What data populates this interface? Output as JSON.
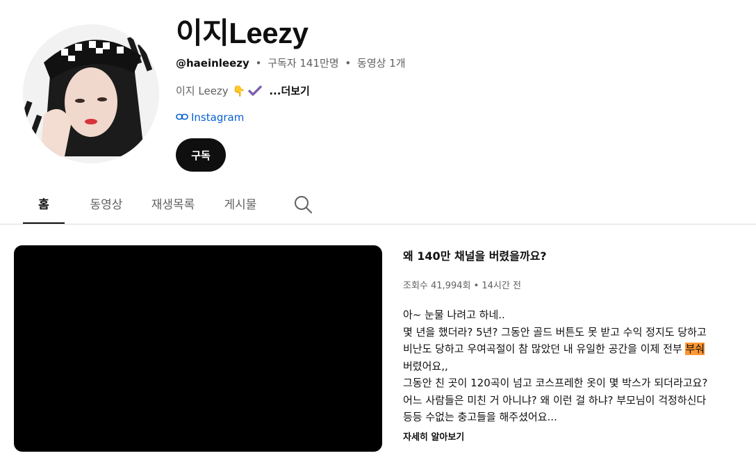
{
  "channel": {
    "name": "이지Leezy",
    "handle": "@haeinleezy",
    "separator": "•",
    "subscribers": "구독자 141만명",
    "videos": "동영상 1개",
    "description": "이지 Leezy",
    "description_emoji": "👇",
    "more_label": "...더보기",
    "link_label": "Instagram",
    "subscribe_label": "구독"
  },
  "tabs": [
    {
      "label": "홈",
      "active": true
    },
    {
      "label": "동영상"
    },
    {
      "label": "재생목록"
    },
    {
      "label": "게시물"
    }
  ],
  "featured_video": {
    "title": "왜 140만 채널을 버렸을까요?",
    "stats": "조회수 41,994회 • 14시간 전",
    "description_lines": [
      "아~ 눈물 나려고 하네..",
      "몇 년을 했더라? 5년? 그동안 골드 버튼도 못 받고 수익 정지도 당하고",
      "비난도 당하고 우여곡절이 참 많았던 내 유일한 공간을 이제 전부 ",
      "버렸어요,,",
      "그동안 친 곳이 120곡이 넘고 코스프레한 옷이 몇 박스가 되더라고요?",
      "어느 사람들은 미친 거 아니냐? 왜 이런 걸 하냐? 부모님이 걱정하신다",
      "등등 수없는 충고들을 해주셨어요..."
    ],
    "highlighted_word": "부숴",
    "read_more": "자세히 알아보기"
  },
  "colors": {
    "link": "#065fd4",
    "highlight": "#ff9632",
    "verified": "#7b5fb0"
  },
  "icons": {
    "verified": "verified-check-icon",
    "link": "link-icon",
    "search": "search-icon"
  }
}
